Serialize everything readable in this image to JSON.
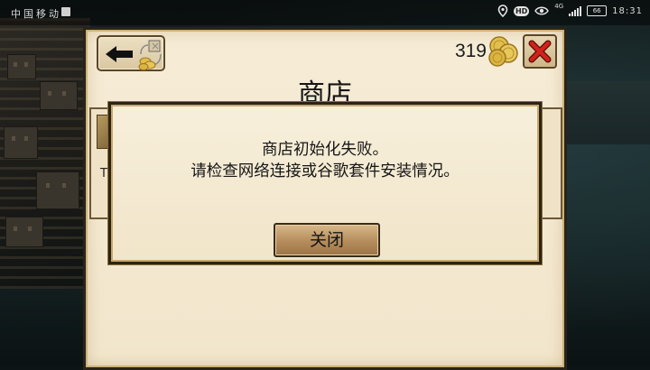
{
  "status_bar": {
    "carrier": "中国移动",
    "network": "4G",
    "hd_label": "HD",
    "battery": "66",
    "time": "18:31"
  },
  "shop": {
    "title": "商店",
    "coins": "319",
    "item_partial_text": "Th"
  },
  "dialog": {
    "message_line1": "商店初始化失败。",
    "message_line2": "请检查网络连接或谷歌套件安装情况。",
    "close_label": "关闭"
  },
  "icons": {
    "back": "back-arrow-icon",
    "exchange": "coin-exchange-icon",
    "coins": "coin-stack-icon",
    "close": "close-x-icon"
  },
  "colors": {
    "parchment": "#f4e9d2",
    "frame": "#2a2317",
    "close_red": "#c4201a",
    "button_brown": "#b58c5c"
  }
}
